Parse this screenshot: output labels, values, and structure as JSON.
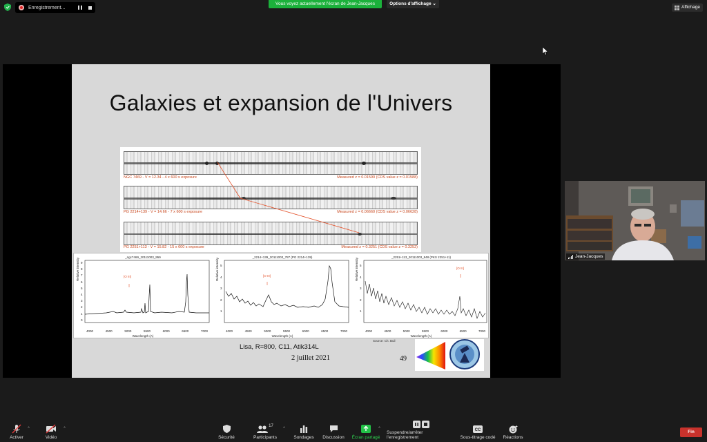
{
  "topbar": {
    "recording_label": "Enregistrement...",
    "share_banner": "Vous voyez actuellement l'écran de Jean-Jacques",
    "view_options": "Options d'affichage",
    "view_menu": "Affichage"
  },
  "slide": {
    "title": "Galaxies et expansion de l'Univers",
    "spectra": [
      {
        "left": "NGC 7469  -  V = 12.34  -  4 x 600 s exposure",
        "right": "Measured z = 0.01590  (CDS value z = 0.01588)"
      },
      {
        "left": "PG 2214+139  -  V = 14.66  -  7 x 600 s exposure",
        "right": "Measured z = 0.06660  (CDS value z = 0.06628)"
      },
      {
        "left": "PG 2251+113  -  V = 15.82  -  15 x 600 s exposure",
        "right": "Measured z = 0.3251  (CDS value z = 0.3252)"
      }
    ],
    "plots": [
      {
        "title": "_ngc7469_20111003_959",
        "line_label": "[O III]",
        "xlabel": "Wavelength (A)",
        "ylabel": "Relative intensity",
        "xticks": [
          "4000",
          "4500",
          "5000",
          "5500",
          "6000",
          "6500",
          "7000"
        ],
        "yticks": [
          "9",
          "8",
          "7",
          "6",
          "5",
          "4",
          "3",
          "2",
          "1",
          "0"
        ]
      },
      {
        "title": "_2214+139_20111003_787   (PG 2214+139)",
        "line_label": "[O III]",
        "xlabel": "Wavelength (A)",
        "ylabel": "Relative intensity",
        "xticks": [
          "4000",
          "4500",
          "5000",
          "5500",
          "6000",
          "6500",
          "7000"
        ],
        "yticks": [
          "5",
          "4",
          "3",
          "2",
          "1"
        ]
      },
      {
        "title": "_2251+113_20111003_848   (PKS 2251+11)",
        "line_label": "[O III]",
        "xlabel": "Wavelength (A)",
        "ylabel": "Relative intensity",
        "xticks": [
          "4000",
          "4500",
          "5000",
          "5500",
          "6000",
          "6500",
          "7000"
        ],
        "yticks": [
          "5",
          "4",
          "3",
          "2",
          "1"
        ]
      }
    ],
    "source": "Source: Ch. Buil",
    "instrument": "Lisa, R=800, C11, Atik314L",
    "date": "2 juillet 2021",
    "slide_number": "49"
  },
  "participant": {
    "name": "Jean-Jacques"
  },
  "toolbar": {
    "mute": "Activer",
    "video": "Vidéo",
    "security": "Sécurité",
    "participants": "Participants",
    "participants_count": "17",
    "polls": "Sondages",
    "chat": "Discussion",
    "share": "Écran partagé",
    "record": "Suspendre/arrêter l'enregistrement",
    "captions": "Sous-titrage codé",
    "reactions": "Réactions",
    "end": "Fin"
  },
  "colors": {
    "share_green": "#1bb13b",
    "end_red": "#c8322c",
    "spectrum_caption": "#c8461c"
  }
}
